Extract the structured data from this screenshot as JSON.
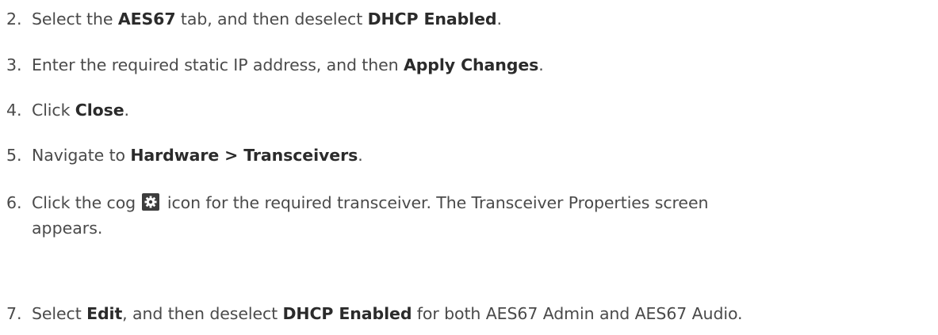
{
  "steps": [
    {
      "number": "2.",
      "parts": [
        "Select the ",
        "AES67",
        " tab, and then deselect ",
        "DHCP Enabled",
        "."
      ]
    },
    {
      "number": "3.",
      "parts": [
        "Enter the required static IP address, and then ",
        "Apply Changes",
        "."
      ]
    },
    {
      "number": "4.",
      "parts": [
        "Click ",
        "Close",
        "."
      ]
    },
    {
      "number": "5.",
      "parts": [
        "Navigate to ",
        "Hardware > Transceivers",
        "."
      ]
    },
    {
      "number": "6.",
      "before_icon": "Click the cog",
      "icon": "cog-icon",
      "after_icon": "icon for the required transceiver. The Transceiver Properties screen",
      "continuation": "appears."
    },
    {
      "number": "7.",
      "parts": [
        "Select ",
        "Edit",
        ", and then deselect ",
        "DHCP Enabled",
        " for both AES67 Admin and AES67 Audio."
      ]
    }
  ]
}
